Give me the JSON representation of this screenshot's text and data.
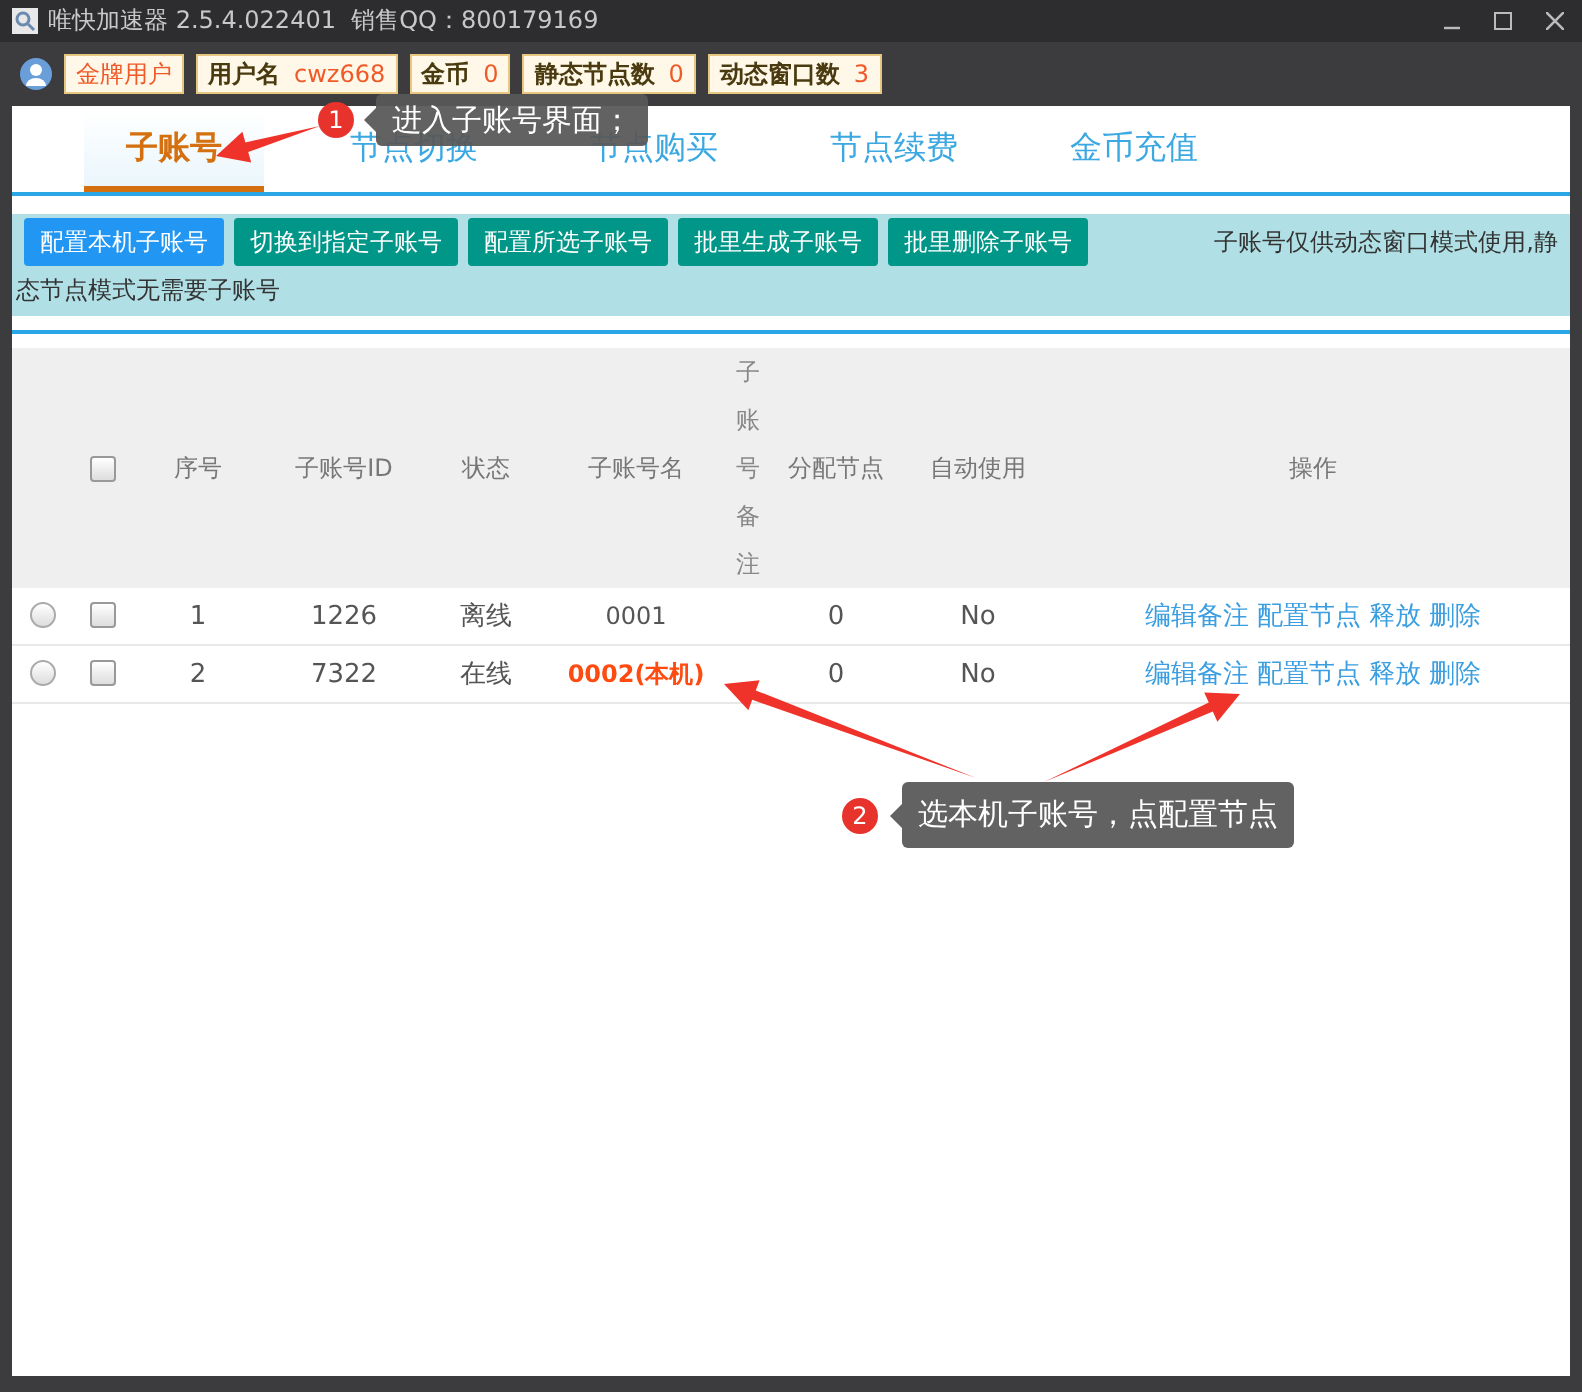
{
  "window": {
    "title": "唯快加速器 2.5.4.022401  销售QQ：800179169"
  },
  "header": {
    "user_level": "金牌用户",
    "stats": [
      {
        "label": "用户名",
        "value": "cwz668"
      },
      {
        "label": "金币",
        "value": "0"
      },
      {
        "label": "静态节点数",
        "value": "0"
      },
      {
        "label": "动态窗口数",
        "value": "3"
      }
    ]
  },
  "tabs": [
    {
      "label": "子账号",
      "selected": true
    },
    {
      "label": "节点切换",
      "selected": false
    },
    {
      "label": "节点购买",
      "selected": false
    },
    {
      "label": "节点续费",
      "selected": false
    },
    {
      "label": "金币充值",
      "selected": false
    }
  ],
  "toolbar": {
    "buttons": [
      {
        "label": "配置本机子账号",
        "kind": "primary"
      },
      {
        "label": "切换到指定子账号",
        "kind": "secondary"
      },
      {
        "label": "配置所选子账号",
        "kind": "secondary"
      },
      {
        "label": "批里生成子账号",
        "kind": "secondary"
      },
      {
        "label": "批里删除子账号",
        "kind": "secondary"
      }
    ],
    "notice_lines": [
      "子账号仅供动态窗口模式使用,静",
      "态节点模式无需要子账号"
    ]
  },
  "table": {
    "header_checked": false,
    "columns": [
      {
        "label": "序号",
        "kind": "normal"
      },
      {
        "label": "子账号ID",
        "kind": "normal"
      },
      {
        "label": "状态",
        "kind": "normal"
      },
      {
        "label": "子账号名",
        "kind": "normal"
      },
      {
        "label": "子账号备注",
        "kind": "vertical"
      },
      {
        "label": "分配节点",
        "kind": "normal"
      },
      {
        "label": "自动使用",
        "kind": "normal"
      },
      {
        "label": "操作",
        "kind": "normal"
      }
    ],
    "rows": [
      {
        "selected": false,
        "checked": false,
        "index": "1",
        "id": "1226",
        "status": "离线",
        "name": "0001",
        "local": false,
        "nodes": "0",
        "auto": "No",
        "actions": [
          "编辑备注",
          "配置节点",
          "释放",
          "删除"
        ]
      },
      {
        "selected": false,
        "checked": false,
        "index": "2",
        "id": "7322",
        "status": "在线",
        "name": "0002(本机)",
        "local": true,
        "nodes": "0",
        "auto": "No",
        "actions": [
          "编辑备注",
          "配置节点",
          "释放",
          "删除"
        ]
      }
    ]
  },
  "annotations": [
    {
      "number": "1",
      "text": "进入子账号界面；"
    },
    {
      "number": "2",
      "text": "选本机子账号，点配置节点"
    }
  ]
}
